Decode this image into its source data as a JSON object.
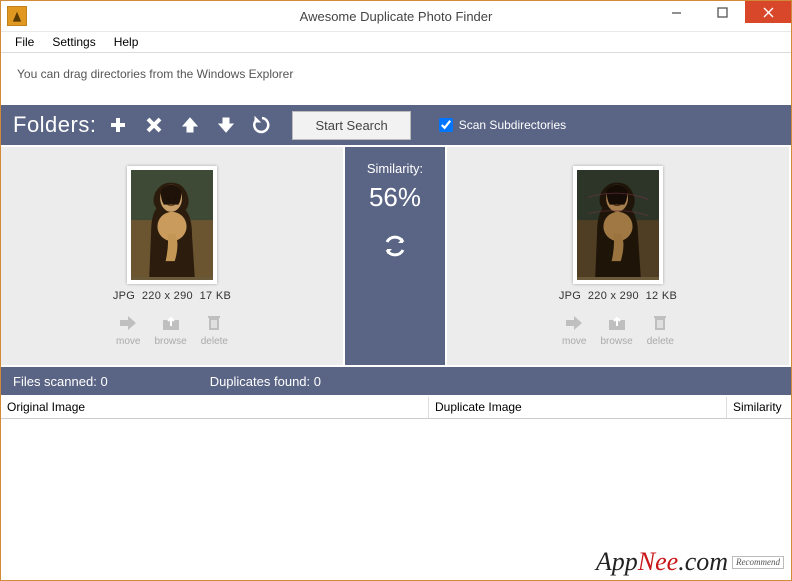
{
  "window": {
    "title": "Awesome Duplicate Photo Finder"
  },
  "menu": {
    "file": "File",
    "settings": "Settings",
    "help": "Help"
  },
  "dropzone": {
    "hint": "You can drag directories from the Windows Explorer"
  },
  "toolbar": {
    "label": "Folders:",
    "start_label": "Start Search",
    "scan_sub_label": "Scan Subdirectories",
    "scan_sub_checked": true
  },
  "similarity": {
    "label": "Similarity:",
    "value": "56%"
  },
  "left": {
    "format": "JPG",
    "dims": "220 x 290",
    "size": "17 KB",
    "actions": {
      "move": "move",
      "browse": "browse",
      "delete": "delete"
    }
  },
  "right": {
    "format": "JPG",
    "dims": "220 x 290",
    "size": "12 KB",
    "actions": {
      "move": "move",
      "browse": "browse",
      "delete": "delete"
    }
  },
  "status": {
    "files_scanned_label": "Files scanned:",
    "files_scanned_value": "0",
    "duplicates_found_label": "Duplicates found:",
    "duplicates_found_value": "0"
  },
  "table": {
    "col_original": "Original Image",
    "col_duplicate": "Duplicate Image",
    "col_similarity": "Similarity"
  },
  "watermark": {
    "brand_a": "App",
    "brand_b": "Nee",
    "brand_c": ".com",
    "tag": "Recommend"
  }
}
